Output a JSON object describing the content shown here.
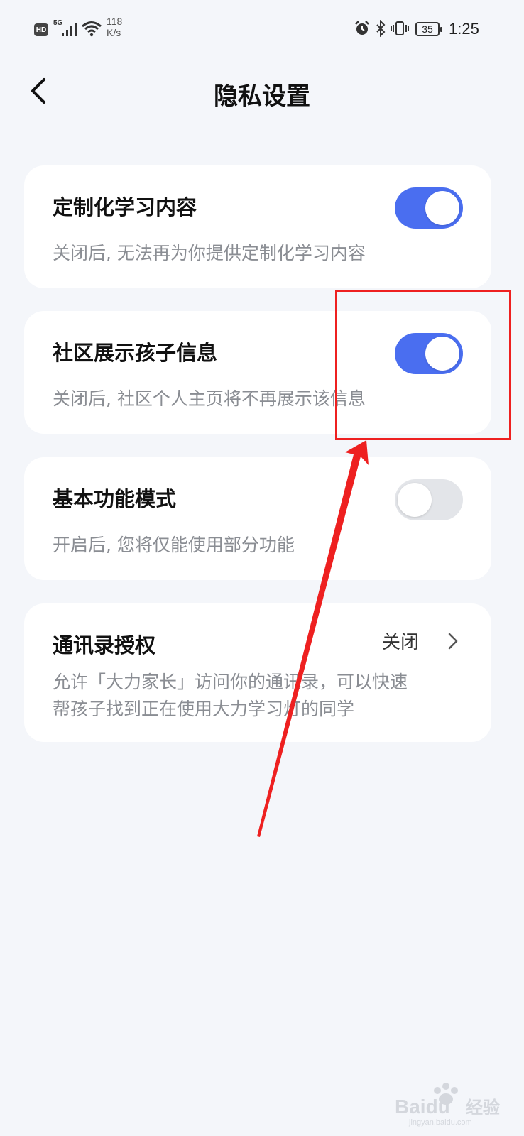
{
  "status_bar": {
    "hd": "HD",
    "network": "5G",
    "speed_value": "118",
    "speed_unit": "K/s",
    "battery": "35",
    "time": "1:25"
  },
  "header": {
    "title": "隐私设置"
  },
  "settings": [
    {
      "title": "定制化学习内容",
      "desc": "关闭后, 无法再为你提供定制化学习内容",
      "toggle": true
    },
    {
      "title": "社区展示孩子信息",
      "desc": "关闭后, 社区个人主页将不再展示该信息",
      "toggle": true
    },
    {
      "title": "基本功能模式",
      "desc": "开启后, 您将仅能使用部分功能",
      "toggle": false
    },
    {
      "title": "通讯录授权",
      "value": "关闭",
      "desc_line1": "允许「大力家长」访问你的通讯录，可以快速",
      "desc_line2": "帮孩子找到正在使用大力学习灯的同学"
    }
  ],
  "colors": {
    "accent": "#4a6ef0",
    "toggle_off": "#e3e5e9",
    "background": "#f4f6fa",
    "annotation": "#ee2020"
  },
  "watermark": {
    "brand": "Baidu",
    "text": "经验",
    "url": "jingyan.baidu.com"
  }
}
